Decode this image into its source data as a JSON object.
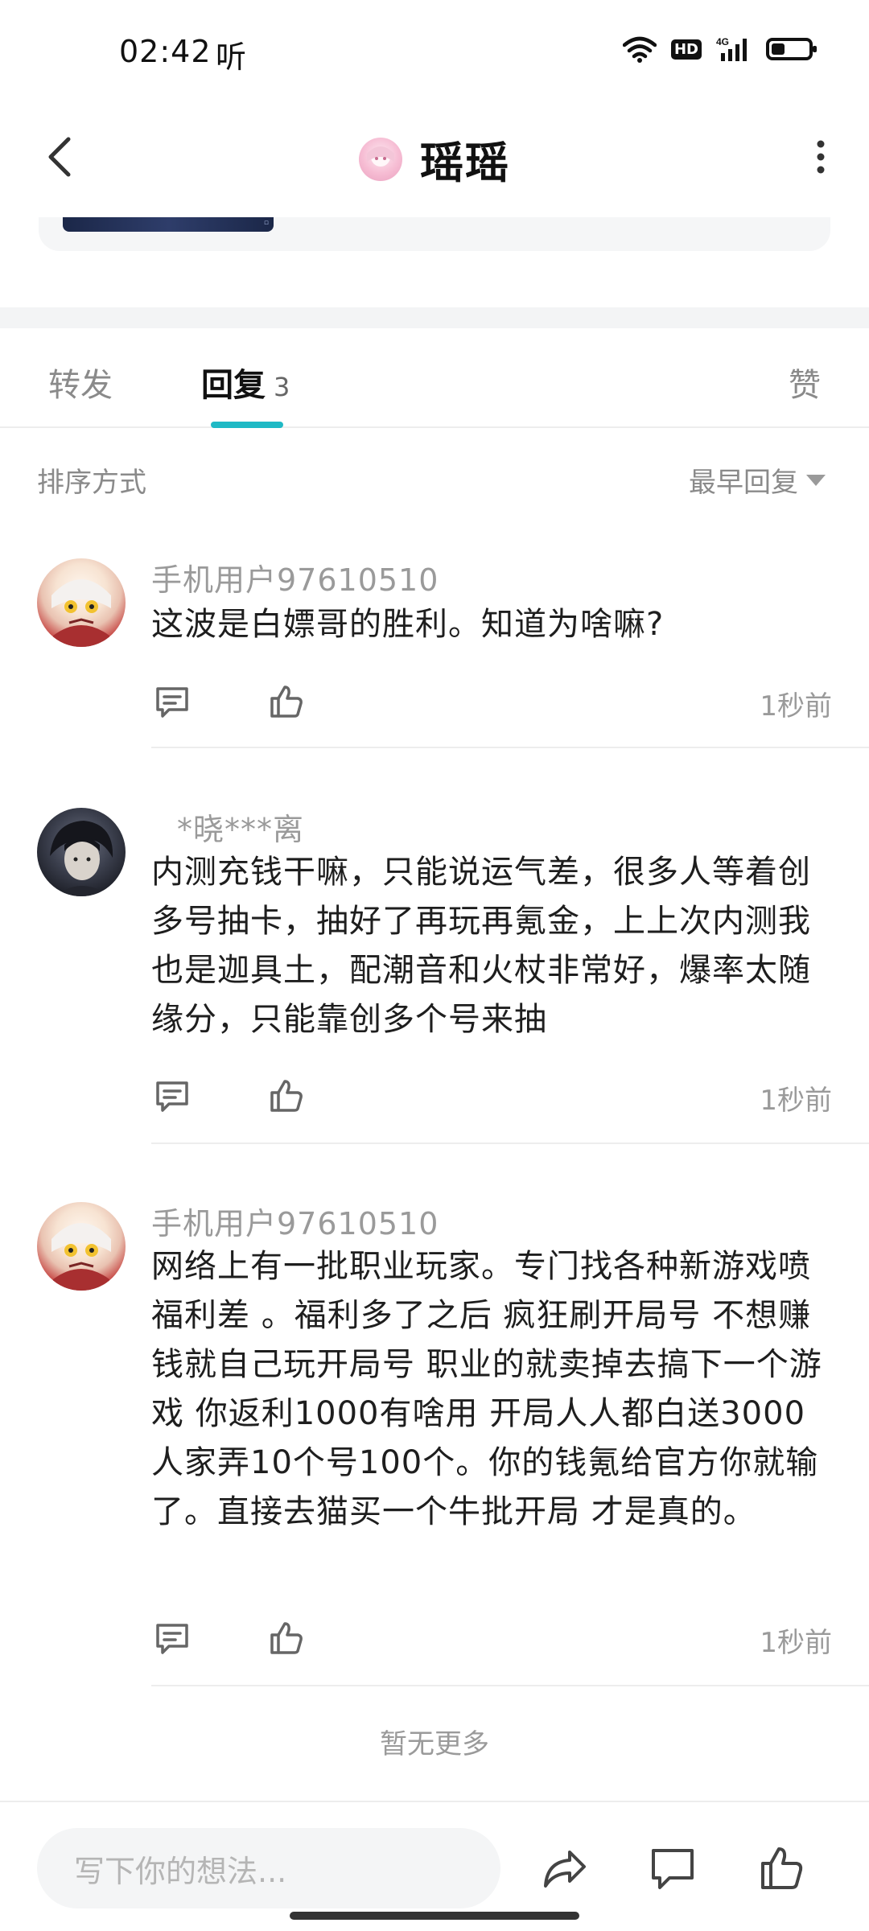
{
  "status_bar": {
    "time": "02:42",
    "extra": "听",
    "network": "4G",
    "hd": "HD"
  },
  "header": {
    "title": "瑶瑶",
    "back_icon": "chevron-left-icon",
    "more_icon": "more-vertical-icon"
  },
  "tabs": {
    "forward": "转发",
    "replies": "回复",
    "replies_count": "3",
    "like": "赞"
  },
  "sort": {
    "label": "排序方式",
    "value": "最早回复"
  },
  "comments": [
    {
      "username": "手机用户97610510",
      "content": "这波是白嫖哥的胜利。知道为啥嘛?",
      "time": "1秒前"
    },
    {
      "username": "*晓***离",
      "content": "内测充钱干嘛，只能说运气差，很多人等着创多号抽卡，抽好了再玩再氪金，上上次内测我也是迦具土，配潮音和火杖非常好，爆率太随缘分，只能靠创多个号来抽",
      "time": "1秒前"
    },
    {
      "username": "手机用户97610510",
      "content": "网络上有一批职业玩家。专门找各种新游戏喷福利差 。福利多了之后  疯狂刷开局号  不想赚钱就自己玩开局号  职业的就卖掉去搞下一个游戏  你返利1000有啥用  开局人人都白送3000  人家弄10个号100个。你的钱氪给官方你就输了。直接去猫买一个牛批开局  才是真的。",
      "time": "1秒前"
    }
  ],
  "footer": {
    "no_more": "暂无更多",
    "input_placeholder": "写下你的想法..."
  },
  "colors": {
    "accent": "#1fb9c5",
    "muted_text": "#9a9a9a",
    "divider": "#ededed"
  }
}
